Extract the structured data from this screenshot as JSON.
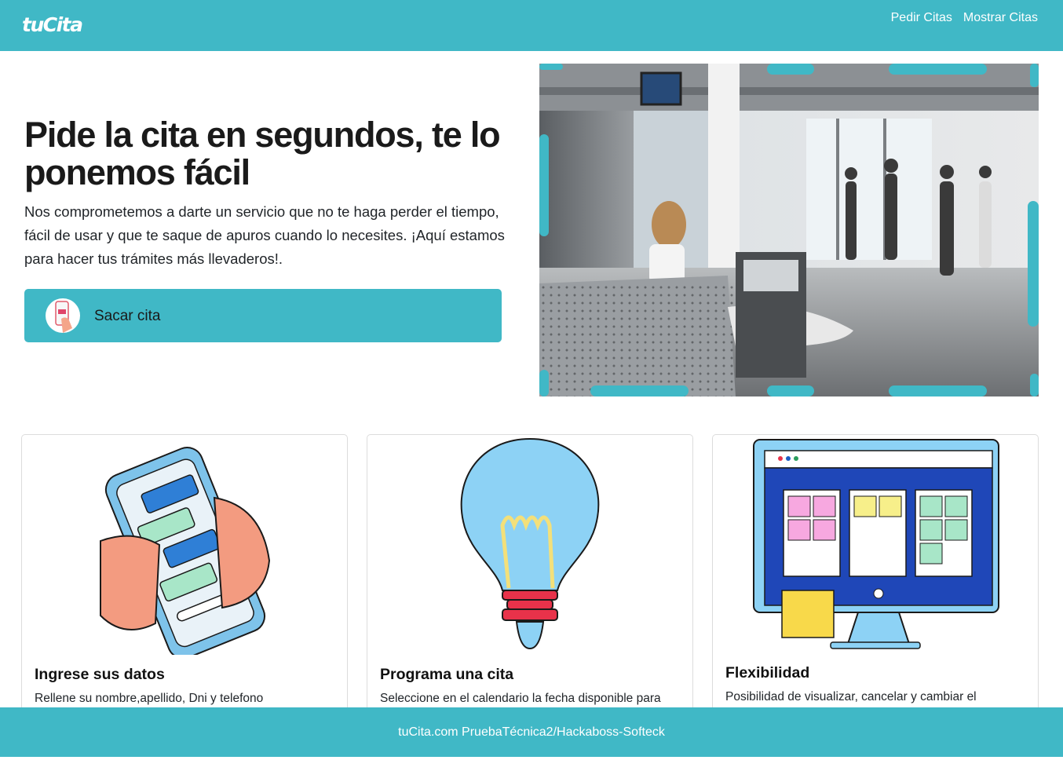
{
  "nav": {
    "logo": "tuCita",
    "links": [
      "Pedir Citas",
      "Mostrar Citas"
    ]
  },
  "hero": {
    "title": "Pide la cita en segundos, te lo ponemos fácil",
    "text": "Nos comprometemos a darte un servicio que no te haga perder el tiempo, fácil de usar y que te saque de apuros cuando lo necesites. ¡Aquí estamos para hacer tus trámites más llevaderos!.",
    "button_label": "Sacar cita",
    "button_icon": "phone-hand-icon",
    "photo": "reception-office-photo"
  },
  "cards": [
    {
      "title": "Ingrese sus datos",
      "text": "Rellene su nombre,apellido, Dni y telefono",
      "icon": "phone-chat-illustration"
    },
    {
      "title": "Programa una cita",
      "text": "Seleccione en el calendario la fecha disponible para",
      "icon": "lightbulb-illustration"
    },
    {
      "title": "Flexibilidad",
      "text": "Posibilidad de visualizar, cancelar y cambiar el",
      "icon": "kanban-monitor-illustration"
    }
  ],
  "footer": {
    "text": "tuCita.com PruebaTécnica2/Hackaboss-Softeck"
  },
  "colors": {
    "accent": "#40b8c6",
    "text": "#212529"
  }
}
